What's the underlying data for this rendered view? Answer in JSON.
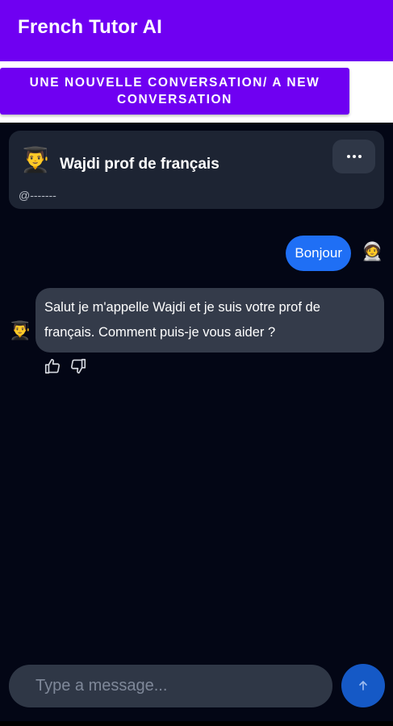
{
  "app": {
    "title": "French Tutor AI",
    "accent_color": "#6f00f2"
  },
  "new_conversation_button": {
    "label": "UNE NOUVELLE CONVERSATION/ A NEW CONVERSATION"
  },
  "bot_card": {
    "avatar_icon": "student-graduate-emoji",
    "avatar": "👨‍🎓",
    "name": "Wajdi prof de français",
    "handle": "@-------",
    "more_icon": "more-dots-icon"
  },
  "messages": [
    {
      "role": "user",
      "text": "Bonjour",
      "avatar_icon": "astronaut-emoji",
      "avatar": "🧑‍🚀"
    },
    {
      "role": "bot",
      "text": "Salut je m'appelle Wajdi et je suis votre prof de français. Comment puis-je vous aider ?",
      "avatar_icon": "student-graduate-emoji",
      "avatar": "👨‍🎓"
    }
  ],
  "feedback": {
    "like_icon": "thumbs-up-icon",
    "dislike_icon": "thumbs-down-icon"
  },
  "composer": {
    "placeholder": "Type a message...",
    "value": "",
    "send_icon": "arrow-up-icon",
    "send_color": "#1559c6"
  },
  "colors": {
    "chat_background": "#030615",
    "card_background": "#1d2433",
    "user_bubble": "#1f6ff5",
    "bot_bubble": "#343b4a"
  }
}
